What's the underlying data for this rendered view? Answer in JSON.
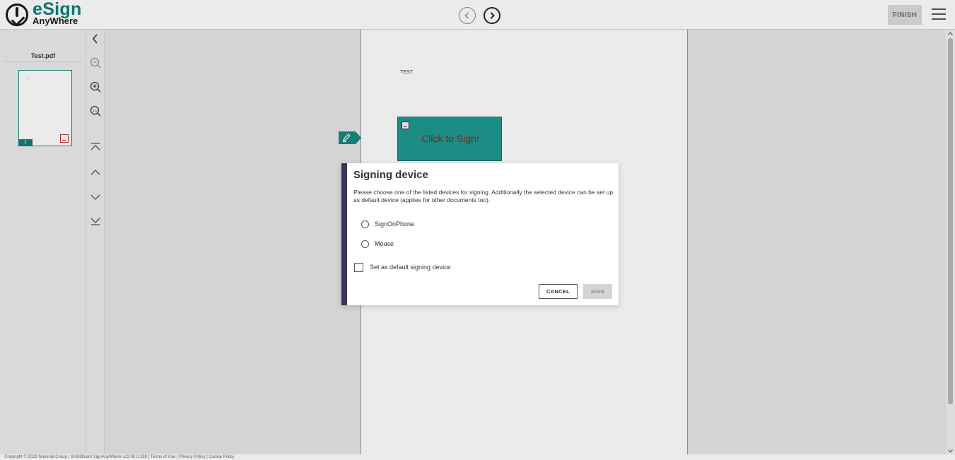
{
  "header": {
    "logo_word": "eSign",
    "logo_sub": "AnyWhere",
    "prev_icon": "chevron-left-circle-icon",
    "next_icon": "chevron-right-circle-icon",
    "finish_label": "FINISH",
    "menu_icon": "hamburger-menu-icon"
  },
  "sidebar": {
    "file_name": "Test.pdf",
    "page_number": "1"
  },
  "tools": [
    "collapse-panel-icon",
    "zoom-out-icon",
    "zoom-in-icon",
    "zoom-fit-icon",
    "first-page-icon",
    "previous-page-icon",
    "next-page-icon",
    "last-page-icon"
  ],
  "document": {
    "text": "TEST",
    "sign_field_label": "Click to Sign!"
  },
  "dialog": {
    "title": "Signing device",
    "description": "Please choose one of the listed devices for signing. Additionally the selected device can be set up as default device (applies for other documents too).",
    "options": [
      {
        "label": "SignOnPhone",
        "selected": false
      },
      {
        "label": "Mouse",
        "selected": false
      }
    ],
    "default_checkbox_label": "Set as default signing device",
    "default_checked": false,
    "cancel_label": "CANCEL",
    "sign_label": "SIGN"
  },
  "footer": {
    "text": "Copyright © 2023 Namirial Group | SIGNificant SignAnyWhere v23.40.0.330 | Terms of Use | Privacy Policy | Cookie Policy"
  },
  "colors": {
    "brand": "#0f7e79",
    "sign_field": "#1f9a90",
    "sign_text": "#a81a1a",
    "dialog_accent": "#36355a"
  }
}
